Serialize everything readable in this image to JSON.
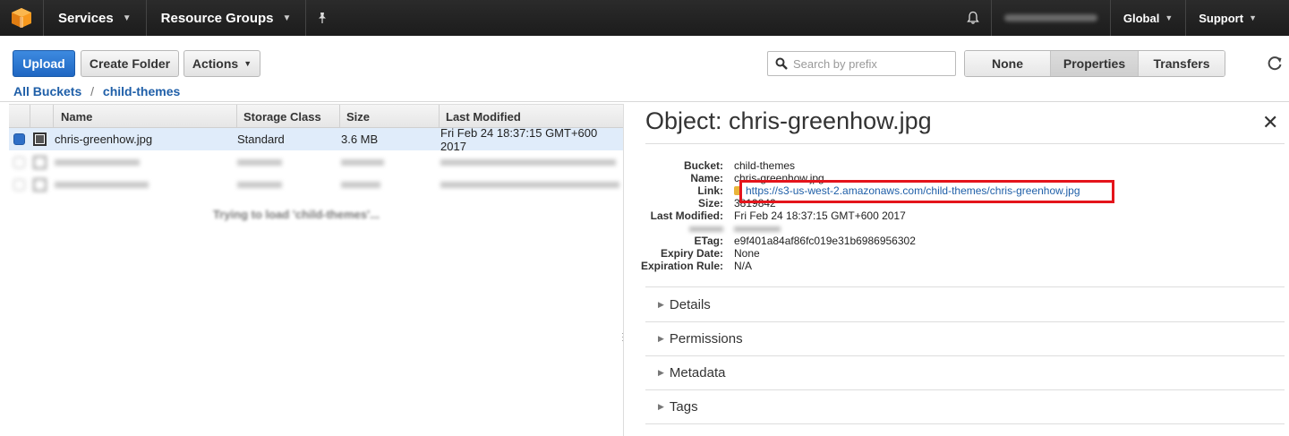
{
  "nav": {
    "services": "Services",
    "resource_groups": "Resource Groups",
    "region": "Global",
    "support": "Support"
  },
  "toolbar": {
    "upload": "Upload",
    "create_folder": "Create Folder",
    "actions": "Actions",
    "search_placeholder": "Search by prefix",
    "view_tabs": [
      "None",
      "Properties",
      "Transfers"
    ],
    "active_tab": "Properties"
  },
  "breadcrumb": {
    "root": "All Buckets",
    "separator": "/",
    "current": "child-themes"
  },
  "table": {
    "columns": [
      "Name",
      "Storage Class",
      "Size",
      "Last Modified"
    ],
    "selected_row": {
      "name": "chris-greenhow.jpg",
      "storage_class": "Standard",
      "size": "3.6 MB",
      "last_modified": "Fri Feb 24 18:37:15 GMT+600 2017"
    },
    "loading_text": "Trying to load 'child-themes'..."
  },
  "object": {
    "title": "Object: chris-greenhow.jpg",
    "properties": [
      {
        "key": "Bucket:",
        "value": "child-themes"
      },
      {
        "key": "Name:",
        "value": "chris-greenhow.jpg"
      },
      {
        "key": "Link:",
        "value": "https://s3-us-west-2.amazonaws.com/child-themes/chris-greenhow.jpg"
      },
      {
        "key": "Size:",
        "value": "3819842"
      },
      {
        "key": "Last Modified:",
        "value": "Fri Feb 24 18:37:15 GMT+600 2017"
      },
      {
        "key": "ETag:",
        "value": "e9f401a84af86fc019e31b6986956302"
      },
      {
        "key": "Expiry Date:",
        "value": "None"
      },
      {
        "key": "Expiration Rule:",
        "value": "N/A"
      }
    ],
    "sections": [
      "Details",
      "Permissions",
      "Metadata",
      "Tags"
    ]
  },
  "icons": {
    "logo": "aws-cube-icon",
    "pin": "pin-icon",
    "bell": "bell-icon",
    "search": "search-icon",
    "refresh": "refresh-icon",
    "close": "close-icon",
    "lock": "lock-icon"
  }
}
